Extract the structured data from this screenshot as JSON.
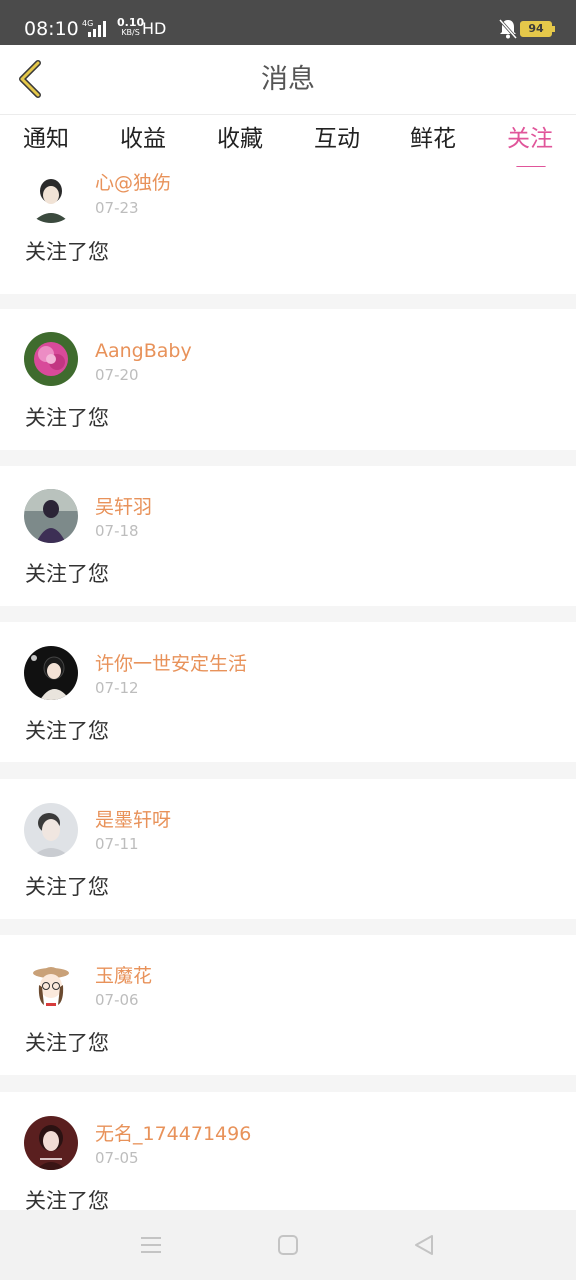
{
  "status_bar": {
    "time": "08:10",
    "network_label": "4G",
    "speed_value": "0.10",
    "speed_unit": "KB/S",
    "hd_label": "HD",
    "battery_level": "94",
    "icons": [
      "signal-icon",
      "bell-muted-icon",
      "battery-icon"
    ]
  },
  "header": {
    "title": "消息",
    "back_icon": "chevron-left-icon"
  },
  "tabs": [
    {
      "label": "通知",
      "active": false
    },
    {
      "label": "收益",
      "active": false
    },
    {
      "label": "收藏",
      "active": false
    },
    {
      "label": "互动",
      "active": false
    },
    {
      "label": "鲜花",
      "active": false
    },
    {
      "label": "关注",
      "active": true
    }
  ],
  "follows": [
    {
      "name": "心@独伤",
      "date": "07-23",
      "message": "关注了您"
    },
    {
      "name": "AangBaby",
      "date": "07-20",
      "message": "关注了您"
    },
    {
      "name": "吴轩羽",
      "date": "07-18",
      "message": "关注了您"
    },
    {
      "name": "许你一世安定生活",
      "date": "07-12",
      "message": "关注了您"
    },
    {
      "name": "是墨轩呀",
      "date": "07-11",
      "message": "关注了您"
    },
    {
      "name": "玉魔花",
      "date": "07-06",
      "message": "关注了您"
    },
    {
      "name": "无名_174471496",
      "date": "07-05",
      "message": "关注了您"
    }
  ],
  "colors": {
    "accent": "#e0559a",
    "name": "#e8925a",
    "date": "#bdbdbd",
    "status_bar": "#4b4b4b",
    "back_icon": "#e5c84a"
  },
  "nav_bar": {
    "icons": [
      "menu-icon",
      "home-square-icon",
      "back-triangle-icon"
    ]
  }
}
